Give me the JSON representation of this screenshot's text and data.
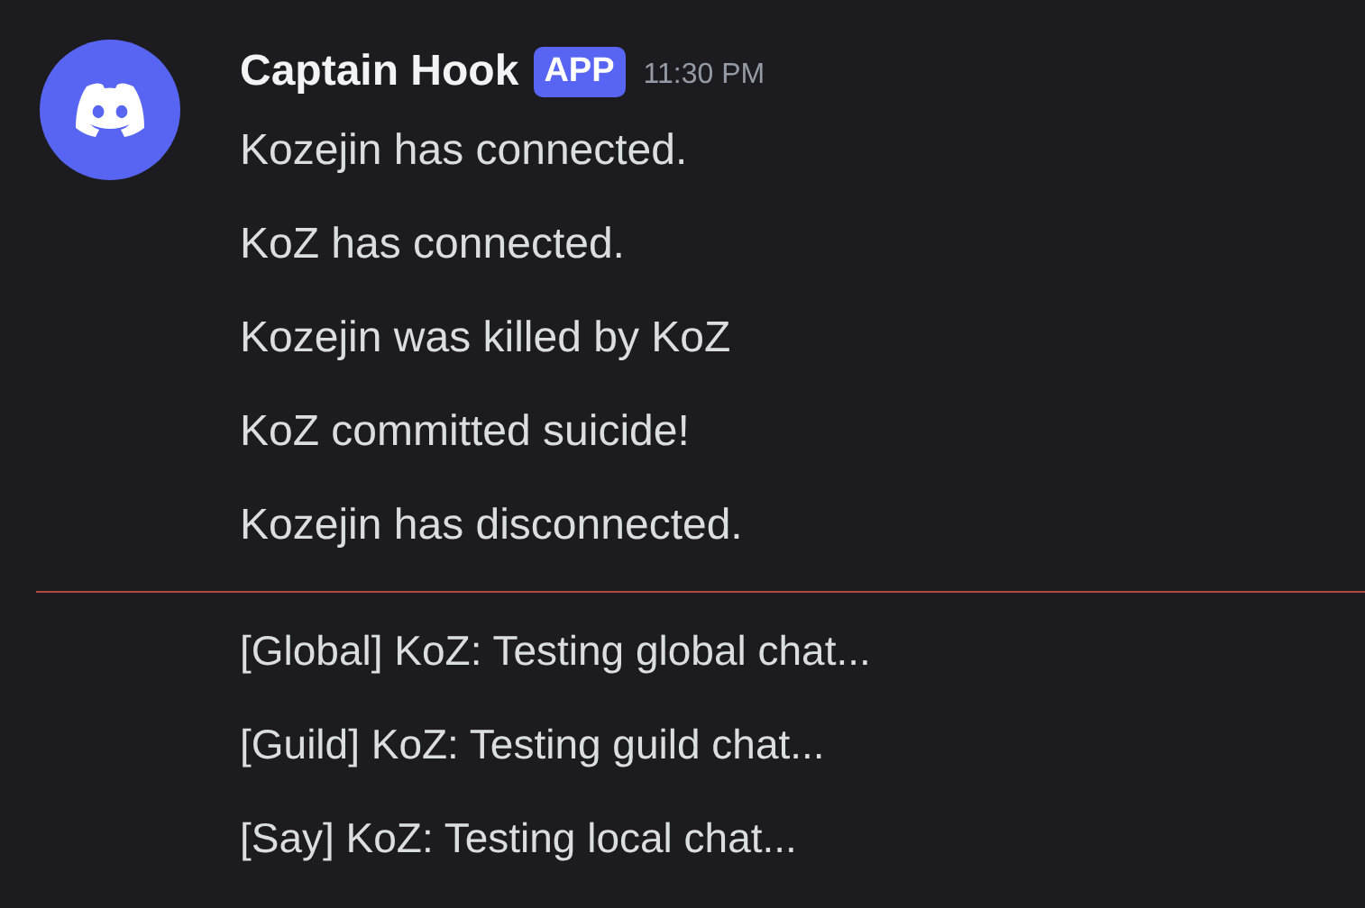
{
  "message": {
    "author": "Captain Hook",
    "badge": "APP",
    "time": "11:30 PM",
    "lines": [
      "Kozejin has connected.",
      "KoZ has connected.",
      "Kozejin was killed by KoZ",
      "KoZ committed suicide!",
      "Kozejin has disconnected."
    ]
  },
  "chat": [
    "[Global] KoZ: Testing global chat...",
    "[Guild] KoZ: Testing guild chat...",
    "[Say] KoZ: Testing local chat..."
  ]
}
